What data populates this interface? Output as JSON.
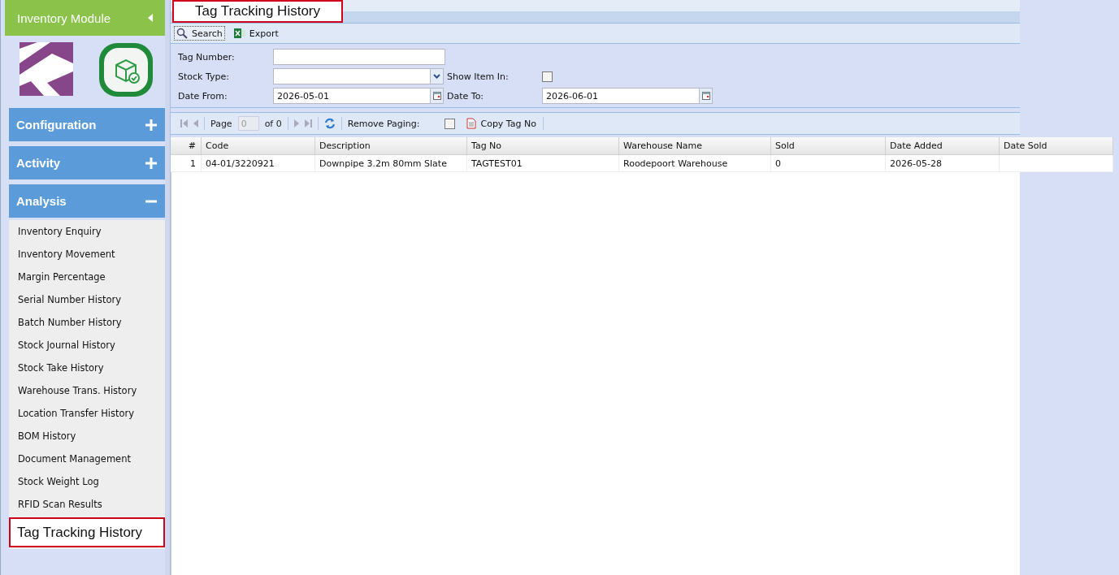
{
  "sidebar": {
    "title": "Inventory Module",
    "sections": [
      {
        "label": "Configuration",
        "expanded": false
      },
      {
        "label": "Activity",
        "expanded": false
      },
      {
        "label": "Analysis",
        "expanded": true,
        "items": [
          {
            "label": "Inventory Enquiry",
            "selected": false
          },
          {
            "label": "Inventory Movement",
            "selected": false
          },
          {
            "label": "Margin Percentage",
            "selected": false
          },
          {
            "label": "Serial Number History",
            "selected": false
          },
          {
            "label": "Batch Number History",
            "selected": false
          },
          {
            "label": "Stock Journal History",
            "selected": false
          },
          {
            "label": "Stock Take History",
            "selected": false
          },
          {
            "label": "Warehouse Trans. History",
            "selected": false
          },
          {
            "label": "Location Transfer History",
            "selected": false
          },
          {
            "label": "BOM History",
            "selected": false
          },
          {
            "label": "Document Management",
            "selected": false
          },
          {
            "label": "Stock Weight Log",
            "selected": false
          },
          {
            "label": "RFID Scan Results",
            "selected": false
          },
          {
            "label": "Tag Tracking History",
            "selected": true
          }
        ]
      }
    ]
  },
  "panel": {
    "title": "Tag Tracking History",
    "toolbar": [
      "Search",
      "Export"
    ],
    "form": {
      "tag_number": {
        "label": "Tag Number:"
      },
      "stock_type": {
        "label": "Stock Type:"
      },
      "show_item_in": {
        "label": "Show Item In:",
        "checked": false
      },
      "date_from": {
        "label": "Date From:",
        "value": "2026-05-01"
      },
      "date_to": {
        "label": "Date To:",
        "value": "2026-06-01"
      }
    },
    "pager": {
      "page_label": "Page",
      "page_value": "0",
      "of_label": "of 0",
      "remove_paging_label": "Remove Paging:",
      "remove_paging": false,
      "copy_label": "Copy Tag No"
    },
    "table": {
      "columns": [
        "#",
        "Code",
        "Description",
        "Tag No",
        "Warehouse Name",
        "Sold",
        "Date Added",
        "Date Sold"
      ],
      "rows": [
        [
          "1",
          "04-01/3220921",
          "Downpipe 3.2m 80mm Slate",
          "TAGTEST01",
          "Roodepoort Warehouse",
          "0",
          "2026-05-28",
          ""
        ]
      ]
    }
  }
}
